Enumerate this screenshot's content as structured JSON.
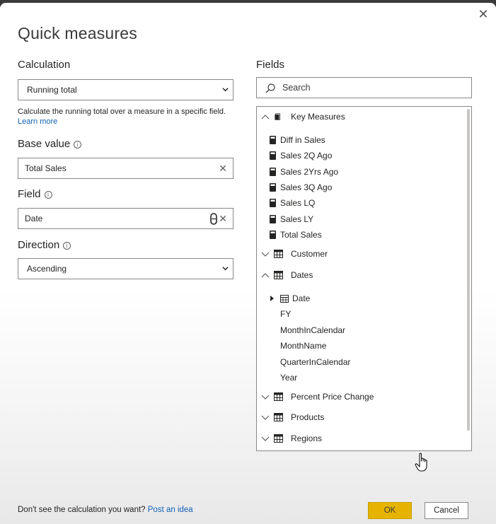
{
  "dialog": {
    "title": "Quick measures"
  },
  "calculation": {
    "label": "Calculation",
    "selected": "Running total",
    "description": "Calculate the running total over a measure in a specific field.",
    "learn_more": "Learn more"
  },
  "base_value": {
    "label": "Base value",
    "value": "Total Sales"
  },
  "field": {
    "label": "Field",
    "value": "Date"
  },
  "direction": {
    "label": "Direction",
    "selected": "Ascending"
  },
  "fields_panel": {
    "label": "Fields",
    "search_placeholder": "Search",
    "key_measures": {
      "label": "Key Measures",
      "items": [
        "Diff in Sales",
        "Sales 2Q Ago",
        "Sales 2Yrs Ago",
        "Sales 3Q Ago",
        "Sales LQ",
        "Sales LY",
        "Total Sales"
      ]
    },
    "customer": {
      "label": "Customer"
    },
    "dates": {
      "label": "Dates",
      "items": [
        "Date",
        "FY",
        "MonthInCalendar",
        "MonthName",
        "QuarterInCalendar",
        "Year"
      ]
    },
    "percent_price_change": {
      "label": "Percent Price Change"
    },
    "products": {
      "label": "Products"
    },
    "regions": {
      "label": "Regions"
    }
  },
  "footer": {
    "question": "Don't see the calculation you want?",
    "post_idea": "Post an idea",
    "ok_label": "OK",
    "cancel_label": "Cancel"
  },
  "colors": {
    "accent": "#e6b400",
    "link": "#1160b5"
  }
}
